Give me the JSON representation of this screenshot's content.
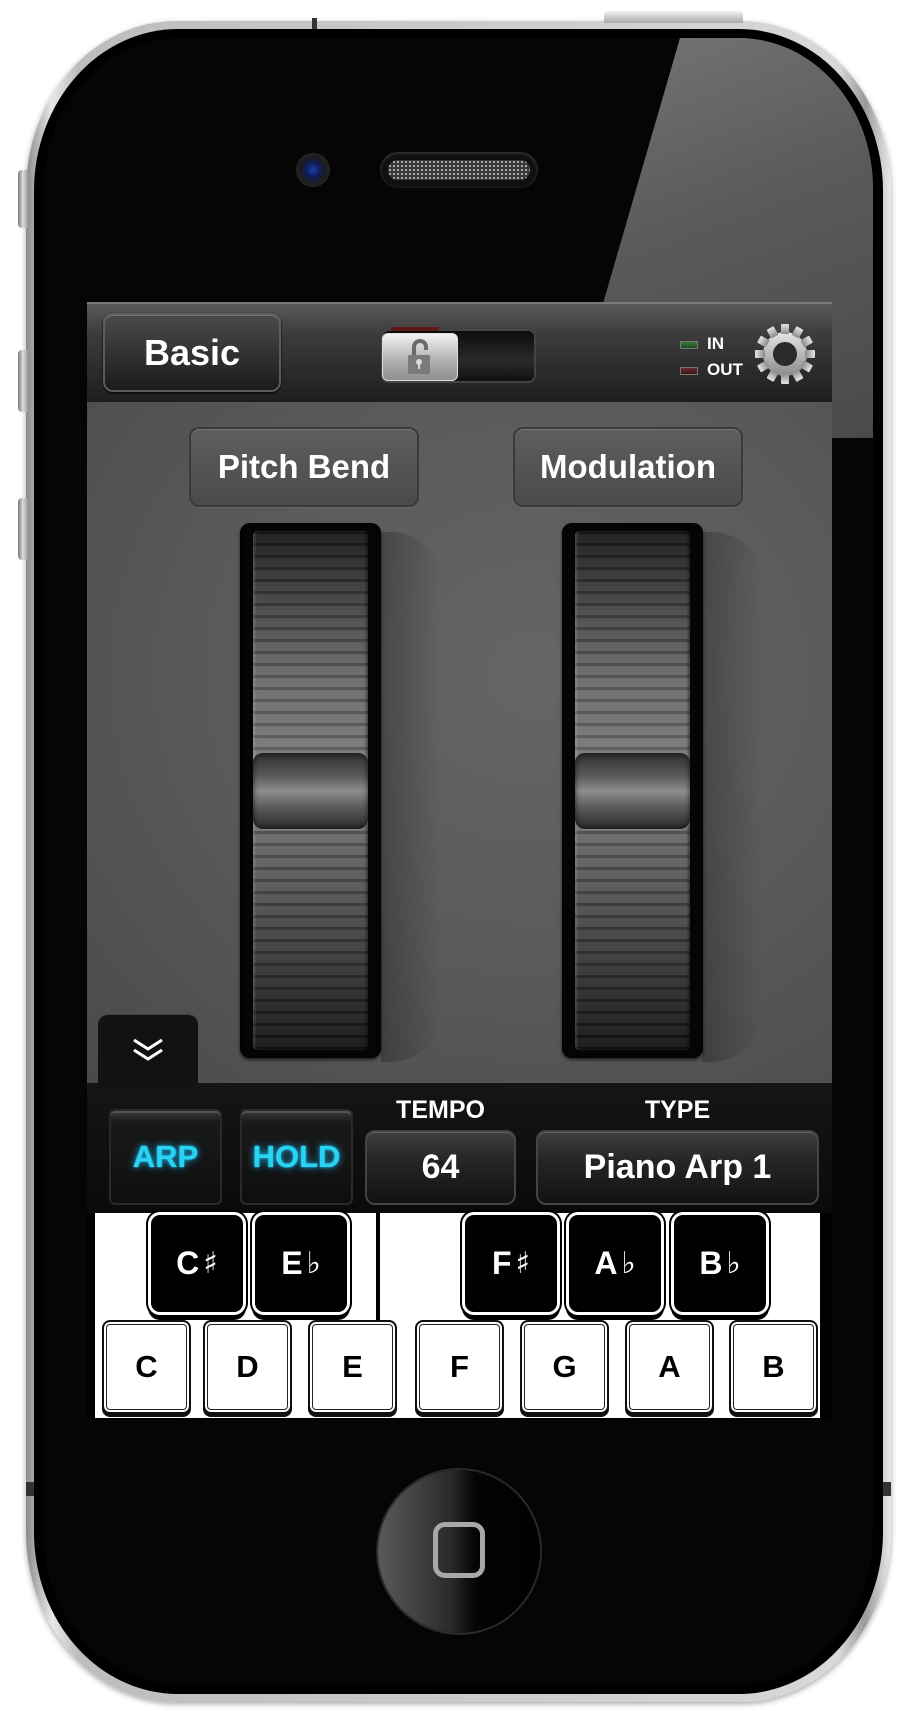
{
  "device": {
    "type": "iPhone",
    "colors": {
      "body": "#000000",
      "bezel": "#d8d8d8"
    }
  },
  "top_bar": {
    "mode_button_label": "Basic",
    "lock_toggle": {
      "state": "unlocked",
      "icon": "unlocked-padlock-icon"
    },
    "midi_indicators": [
      {
        "label": "IN",
        "color": "#3a7a3a"
      },
      {
        "label": "OUT",
        "color": "#6a2a30"
      }
    ],
    "settings_icon": "gear-icon"
  },
  "controllers": {
    "pitch_bend": {
      "label": "Pitch Bend",
      "value_fraction": 0.5
    },
    "modulation": {
      "label": "Modulation",
      "value_fraction": 0.5
    }
  },
  "collapse_tab": {
    "icon": "double-chevron-down-icon"
  },
  "arpeggiator": {
    "arp_label": "ARP",
    "hold_label": "HOLD",
    "active_color": "#29d4f2",
    "tempo_label": "TEMPO",
    "tempo_value": "64",
    "type_label": "TYPE",
    "type_value": "Piano Arp 1"
  },
  "keyboard": {
    "white_keys": [
      "C",
      "D",
      "E",
      "F",
      "G",
      "A",
      "B"
    ],
    "black_keys": [
      {
        "note": "C",
        "accidental": "♯"
      },
      {
        "note": "E",
        "accidental": "♭"
      },
      {
        "note": "F",
        "accidental": "♯"
      },
      {
        "note": "A",
        "accidental": "♭"
      },
      {
        "note": "B",
        "accidental": "♭"
      }
    ]
  },
  "home_button": {
    "icon": "home-square-icon"
  }
}
